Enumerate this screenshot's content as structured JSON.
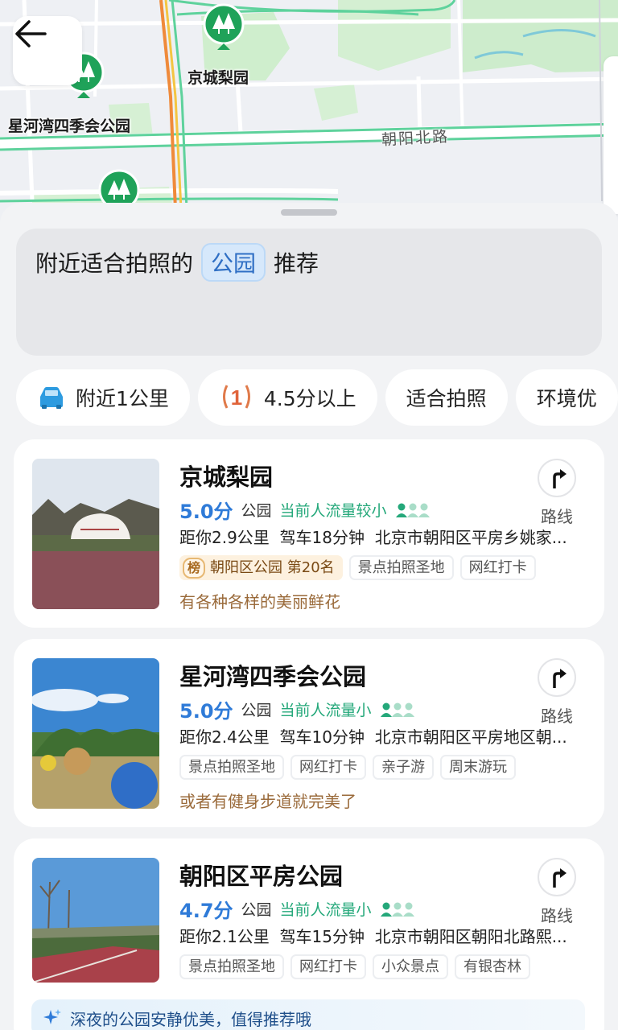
{
  "map": {
    "labels": {
      "jingcheng": "京城梨园",
      "xinghewan": "星河湾四季会公园",
      "road": "朝阳北路"
    }
  },
  "query": {
    "prefix": "附近适合拍照的",
    "chip": "公园",
    "suffix": "推荐"
  },
  "filters": [
    {
      "label": "附近1公里",
      "icon": "car-icon"
    },
    {
      "label": "4.5分以上",
      "icon": "rank-1-icon"
    },
    {
      "label": "适合拍照"
    },
    {
      "label": "环境优"
    }
  ],
  "results": [
    {
      "name": "京城梨园",
      "score": "5.0分",
      "category": "公园",
      "crowd": "当前人流量较小",
      "distance": "距你2.9公里",
      "drive": "驾车18分钟",
      "address": "北京市朝阳区平房乡姚家...",
      "rank": {
        "badge": "榜",
        "text": "朝阳区公园 第20名"
      },
      "tags": [
        "景点拍照圣地",
        "网红打卡"
      ],
      "quote": "有各种各样的美丽鲜花",
      "route": "路线"
    },
    {
      "name": "星河湾四季会公园",
      "score": "5.0分",
      "category": "公园",
      "crowd": "当前人流量小",
      "distance": "距你2.4公里",
      "drive": "驾车10分钟",
      "address": "北京市朝阳区平房地区朝...",
      "tags": [
        "景点拍照圣地",
        "网红打卡",
        "亲子游",
        "周末游玩"
      ],
      "quote": "或者有健身步道就完美了",
      "route": "路线"
    },
    {
      "name": "朝阳区平房公园",
      "score": "4.7分",
      "category": "公园",
      "crowd": "当前人流量小",
      "distance": "距你2.1公里",
      "drive": "驾车15分钟",
      "address": "北京市朝阳区朝阳北路熙...",
      "tags": [
        "景点拍照圣地",
        "网红打卡",
        "小众景点",
        "有银杏林"
      ],
      "ai_tip": "深夜的公园安静优美，值得推荐哦",
      "route": "路线"
    }
  ],
  "colors": {
    "accent": "#2f7bd8",
    "crowd_green": "#24a87a",
    "quote_brown": "#9a6a3a",
    "park_green": "#cbeccb"
  }
}
